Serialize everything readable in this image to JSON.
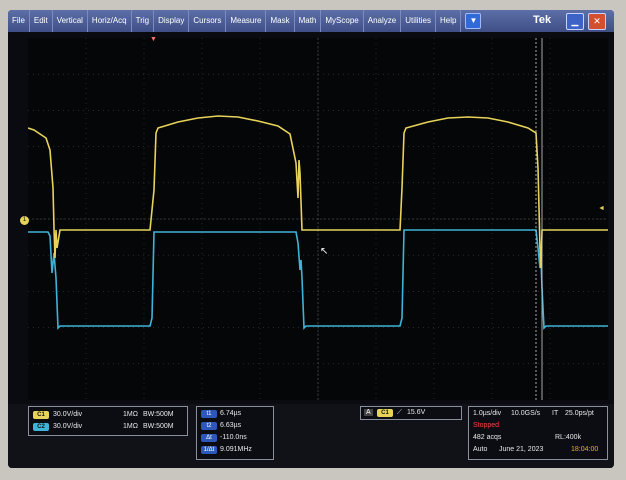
{
  "menu": {
    "items": [
      "File",
      "Edit",
      "Vertical",
      "Horiz/Acq",
      "Trig",
      "Display",
      "Cursors",
      "Measure",
      "Mask",
      "Math",
      "MyScope",
      "Analyze",
      "Utilities",
      "Help"
    ],
    "dropdown_icon": "triangle-down-icon"
  },
  "brand": "Tek",
  "window_buttons": {
    "minimize_icon": "minimize-icon",
    "close_icon": "close-icon"
  },
  "colors": {
    "ch1": "#e7d35a",
    "ch2": "#3fb4d8",
    "background": "#050608",
    "stopped": "#ff4040"
  },
  "channels": [
    {
      "badge": "C1",
      "scale": "30.0V/div",
      "impedance": "1MΩ",
      "bandwidth": "BW:500M"
    },
    {
      "badge": "C2",
      "scale": "30.0V/div",
      "impedance": "1MΩ",
      "bandwidth": "BW:500M"
    }
  ],
  "cursors": [
    {
      "badge": "t1",
      "value": "6.74µs"
    },
    {
      "badge": "t2",
      "value": "6.63µs"
    },
    {
      "badge": "Δt",
      "value": "-110.0ns"
    },
    {
      "badge": "1/Δt",
      "value": "9.091MHz"
    }
  ],
  "trigger": {
    "mode_label": "A",
    "source": "C1",
    "slope_icon": "rising-edge-icon",
    "level": "15.6V"
  },
  "acquisition": {
    "horizontal": "1.0µs/div",
    "sample_rate": "10.0GS/s",
    "mode": "IT",
    "resolution": "25.0ps/pt",
    "state": "Stopped",
    "acqs": "482 acqs",
    "record_length": "RL:400k",
    "trigger_mode": "Auto",
    "date": "June 21, 2023",
    "time": "18:04:00"
  },
  "markers": {
    "ch_ground": "1",
    "trigger_position": "▼",
    "trigger_level": "◄"
  }
}
